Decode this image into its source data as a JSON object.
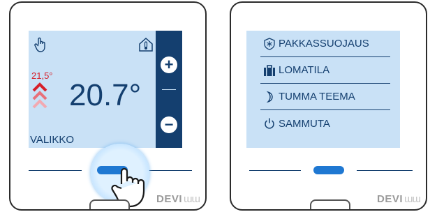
{
  "left_panel": {
    "setpoint": "21,5°",
    "current_temperature": "20.7°",
    "menu_label": "VALIKKO",
    "plus_label": "+",
    "minus_label": "−",
    "brand": "DEVI",
    "icons": [
      "hand-icon",
      "house-thermometer-icon",
      "heating-arrows-icon",
      "tap-hand-icon"
    ]
  },
  "right_panel": {
    "menu_items": [
      {
        "label": "PAKKASSUOJAUS",
        "icon": "frost-protection-icon"
      },
      {
        "label": "LOMATILA",
        "icon": "suitcase-icon"
      },
      {
        "label": "TUMMA TEEMA",
        "icon": "moon-icon"
      },
      {
        "label": "SAMMUTA",
        "icon": "power-icon"
      }
    ],
    "brand": "DEVI"
  },
  "colors": {
    "screen_bg": "#c9e1f6",
    "accent_dark": "#143f6f",
    "heating_red": "#d61e28",
    "button_blue": "#1f78d2"
  }
}
